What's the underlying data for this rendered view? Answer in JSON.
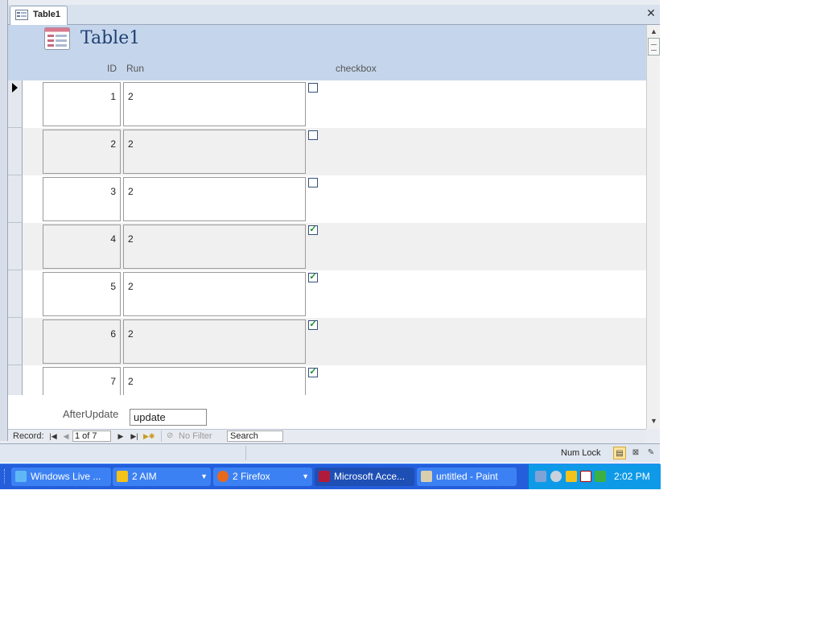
{
  "document_tab": {
    "title": "Table1"
  },
  "form": {
    "title": "Table1",
    "column_headers": {
      "id": "ID",
      "run": "Run",
      "checkbox": "checkbox"
    },
    "records": [
      {
        "id": "1",
        "run": "2",
        "checked": false
      },
      {
        "id": "2",
        "run": "2",
        "checked": false
      },
      {
        "id": "3",
        "run": "2",
        "checked": false
      },
      {
        "id": "4",
        "run": "2",
        "checked": true
      },
      {
        "id": "5",
        "run": "2",
        "checked": true
      },
      {
        "id": "6",
        "run": "2",
        "checked": true
      },
      {
        "id": "7",
        "run": "2",
        "checked": true
      }
    ],
    "footer": {
      "after_update_label": "AfterUpdate",
      "after_update_value": "update"
    }
  },
  "navigation": {
    "record_label": "Record:",
    "position": "1 of 7",
    "filter_label": "No Filter",
    "search_label": "Search"
  },
  "status_bar": {
    "num_lock": "Num Lock"
  },
  "taskbar": {
    "buttons": [
      {
        "label": "Windows Live ...",
        "icon": "windows-live-icon",
        "active": false
      },
      {
        "label": "2 AIM",
        "icon": "aim-icon",
        "active": false
      },
      {
        "label": "2 Firefox",
        "icon": "firefox-icon",
        "active": false
      },
      {
        "label": "Microsoft Acce...",
        "icon": "access-icon",
        "active": true
      },
      {
        "label": "untitled - Paint",
        "icon": "paint-icon",
        "active": false
      }
    ],
    "clock": "2:02 PM"
  },
  "colors": {
    "header_band": "#c5d6ec",
    "alt_row": "#f0f0f0",
    "taskbar": "#245edb",
    "tray": "#0f9ae8",
    "check": "#1a8a2a"
  }
}
